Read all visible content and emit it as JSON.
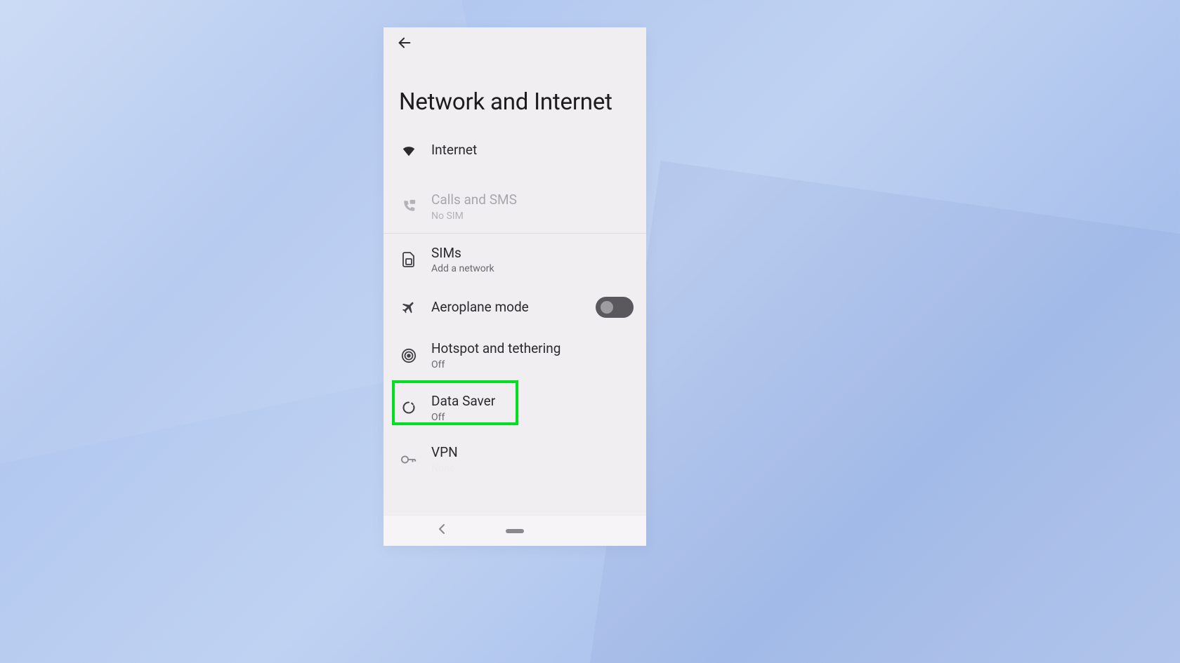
{
  "header": {
    "title": "Network and Internet"
  },
  "items": {
    "internet": {
      "label": "Internet"
    },
    "calls": {
      "label": "Calls and SMS",
      "sub": "No SIM"
    },
    "sims": {
      "label": "SIMs",
      "sub": "Add a network"
    },
    "aeroplane": {
      "label": "Aeroplane mode"
    },
    "hotspot": {
      "label": "Hotspot and tethering",
      "sub": "Off"
    },
    "datasaver": {
      "label": "Data Saver",
      "sub": "Off"
    },
    "vpn": {
      "label": "VPN",
      "sub": "None"
    }
  },
  "toggles": {
    "aeroplane": false
  },
  "highlight_target": "datasaver",
  "colors": {
    "highlight": "#00e020",
    "screen_bg": "#f1eef2"
  }
}
